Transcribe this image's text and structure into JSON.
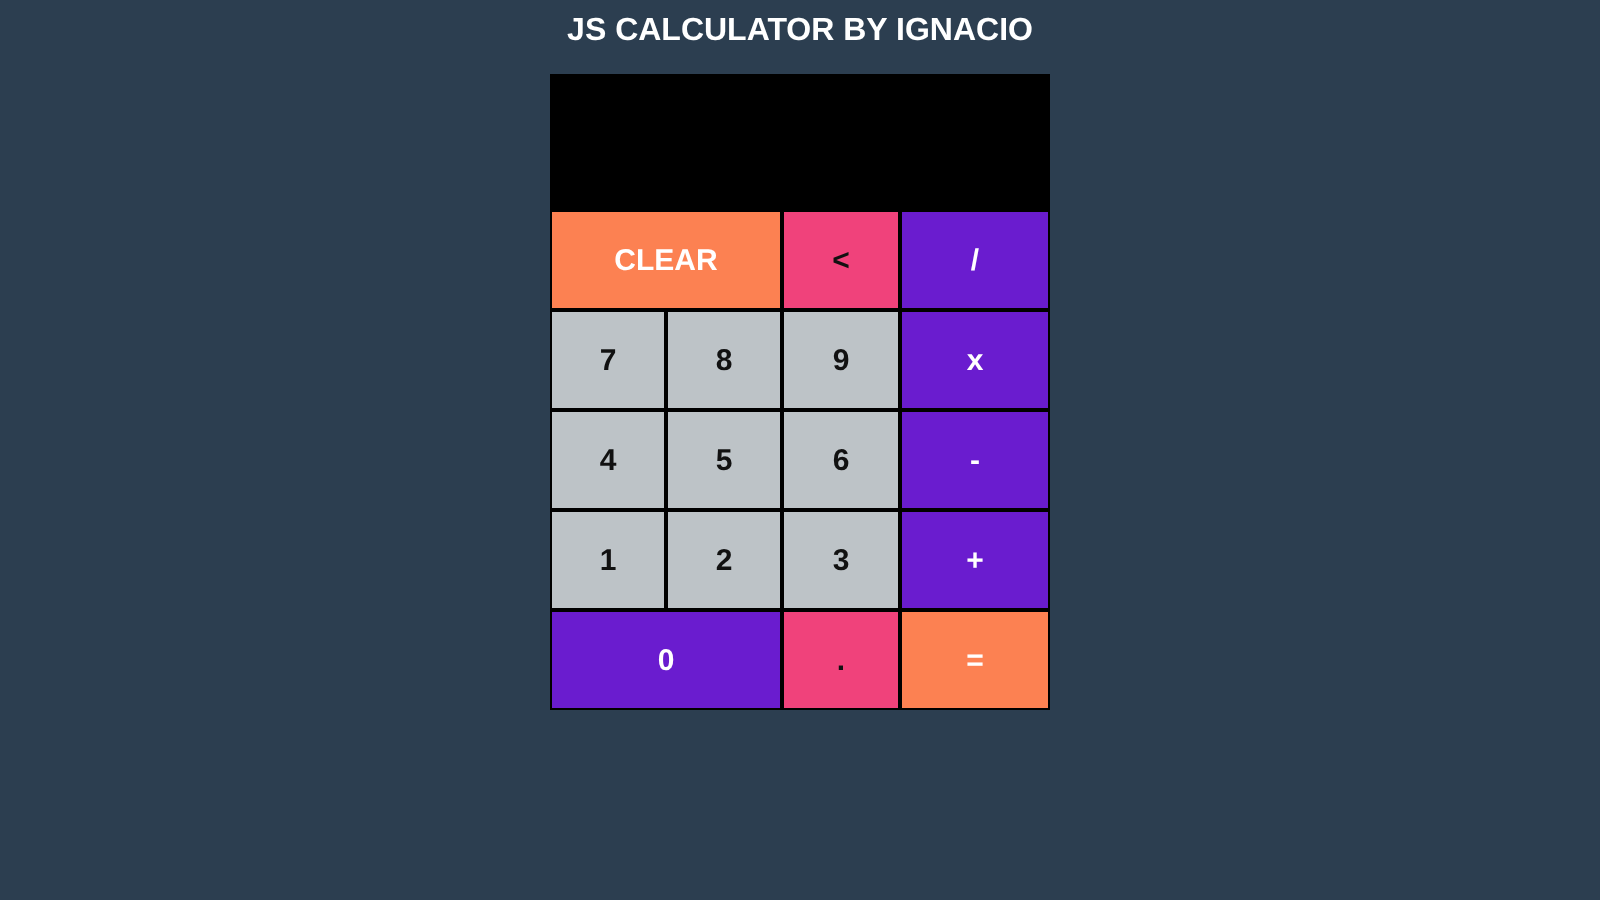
{
  "title": "JS CALCULATOR BY IGNACIO",
  "keys": [
    {
      "label": "CLEAR",
      "kind": "clear",
      "wide": true
    },
    {
      "label": "<",
      "kind": "delete",
      "wide": false
    },
    {
      "label": "/",
      "kind": "operator",
      "wide": false
    },
    {
      "label": "7",
      "kind": "digit",
      "wide": false
    },
    {
      "label": "8",
      "kind": "digit",
      "wide": false
    },
    {
      "label": "9",
      "kind": "digit",
      "wide": false
    },
    {
      "label": "x",
      "kind": "operator",
      "wide": false
    },
    {
      "label": "4",
      "kind": "digit",
      "wide": false
    },
    {
      "label": "5",
      "kind": "digit",
      "wide": false
    },
    {
      "label": "6",
      "kind": "digit",
      "wide": false
    },
    {
      "label": "-",
      "kind": "operator",
      "wide": false
    },
    {
      "label": "1",
      "kind": "digit",
      "wide": false
    },
    {
      "label": "2",
      "kind": "digit",
      "wide": false
    },
    {
      "label": "3",
      "kind": "digit",
      "wide": false
    },
    {
      "label": "+",
      "kind": "operator",
      "wide": false
    },
    {
      "label": "0",
      "kind": "zero",
      "wide": true
    },
    {
      "label": ".",
      "kind": "delete",
      "wide": false
    },
    {
      "label": "=",
      "kind": "clear",
      "wide": false
    }
  ]
}
